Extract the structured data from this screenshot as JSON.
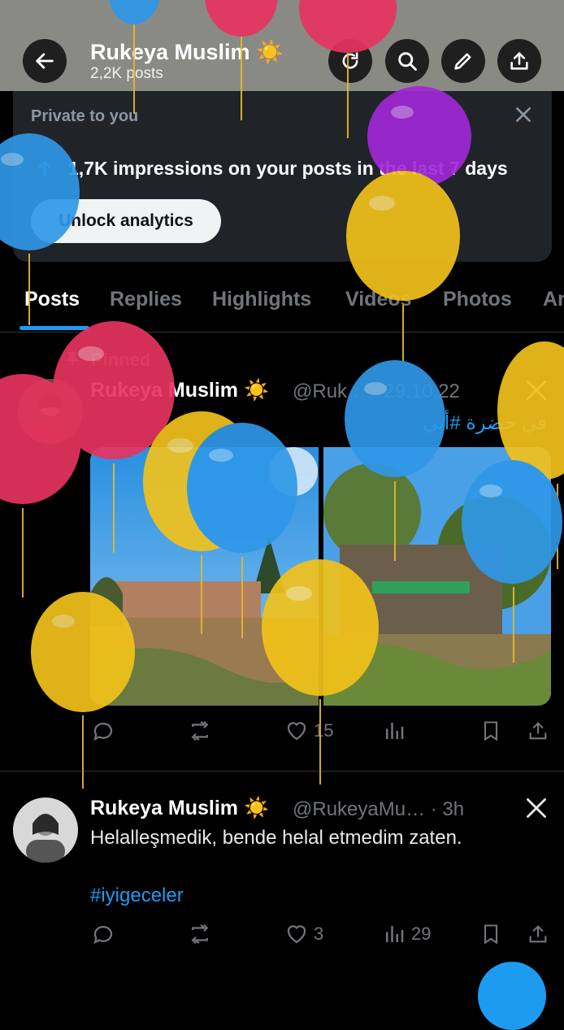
{
  "header": {
    "name": "Rukeya Muslim ☀️",
    "posts_count": "2,2K posts",
    "icons": [
      "back-arrow-icon",
      "refresh-icon",
      "search-icon",
      "edit-icon",
      "share-icon"
    ]
  },
  "analytics": {
    "private_label": "Private to you",
    "text": "1,7K impressions on your posts in the last 7 days",
    "button": "Unlock analytics"
  },
  "tabs": [
    "Posts",
    "Replies",
    "Highlights",
    "Videos",
    "Photos",
    "Ar"
  ],
  "pinned_post": {
    "pinned_label": "Pinned",
    "name": "Rukeya Muslim ☀️",
    "handle_date": "@Ruk… · 29.10.22",
    "text": "في حضرة #أبي",
    "like_count": "15"
  },
  "second_post": {
    "name": "Rukeya Muslim ☀️",
    "handle_time": "@RukeyaMu… · 3h",
    "text": "Helalleşmedik, bende helal etmedim zaten.",
    "hashtag": "#iyigeceler",
    "like_count": "3",
    "view_count": "29"
  },
  "colors": {
    "accent": "#1d9bf0",
    "balloon_red": "#e8345f",
    "balloon_yellow": "#f2c21b",
    "balloon_blue": "#2f98e8",
    "balloon_purple": "#a128d8"
  }
}
